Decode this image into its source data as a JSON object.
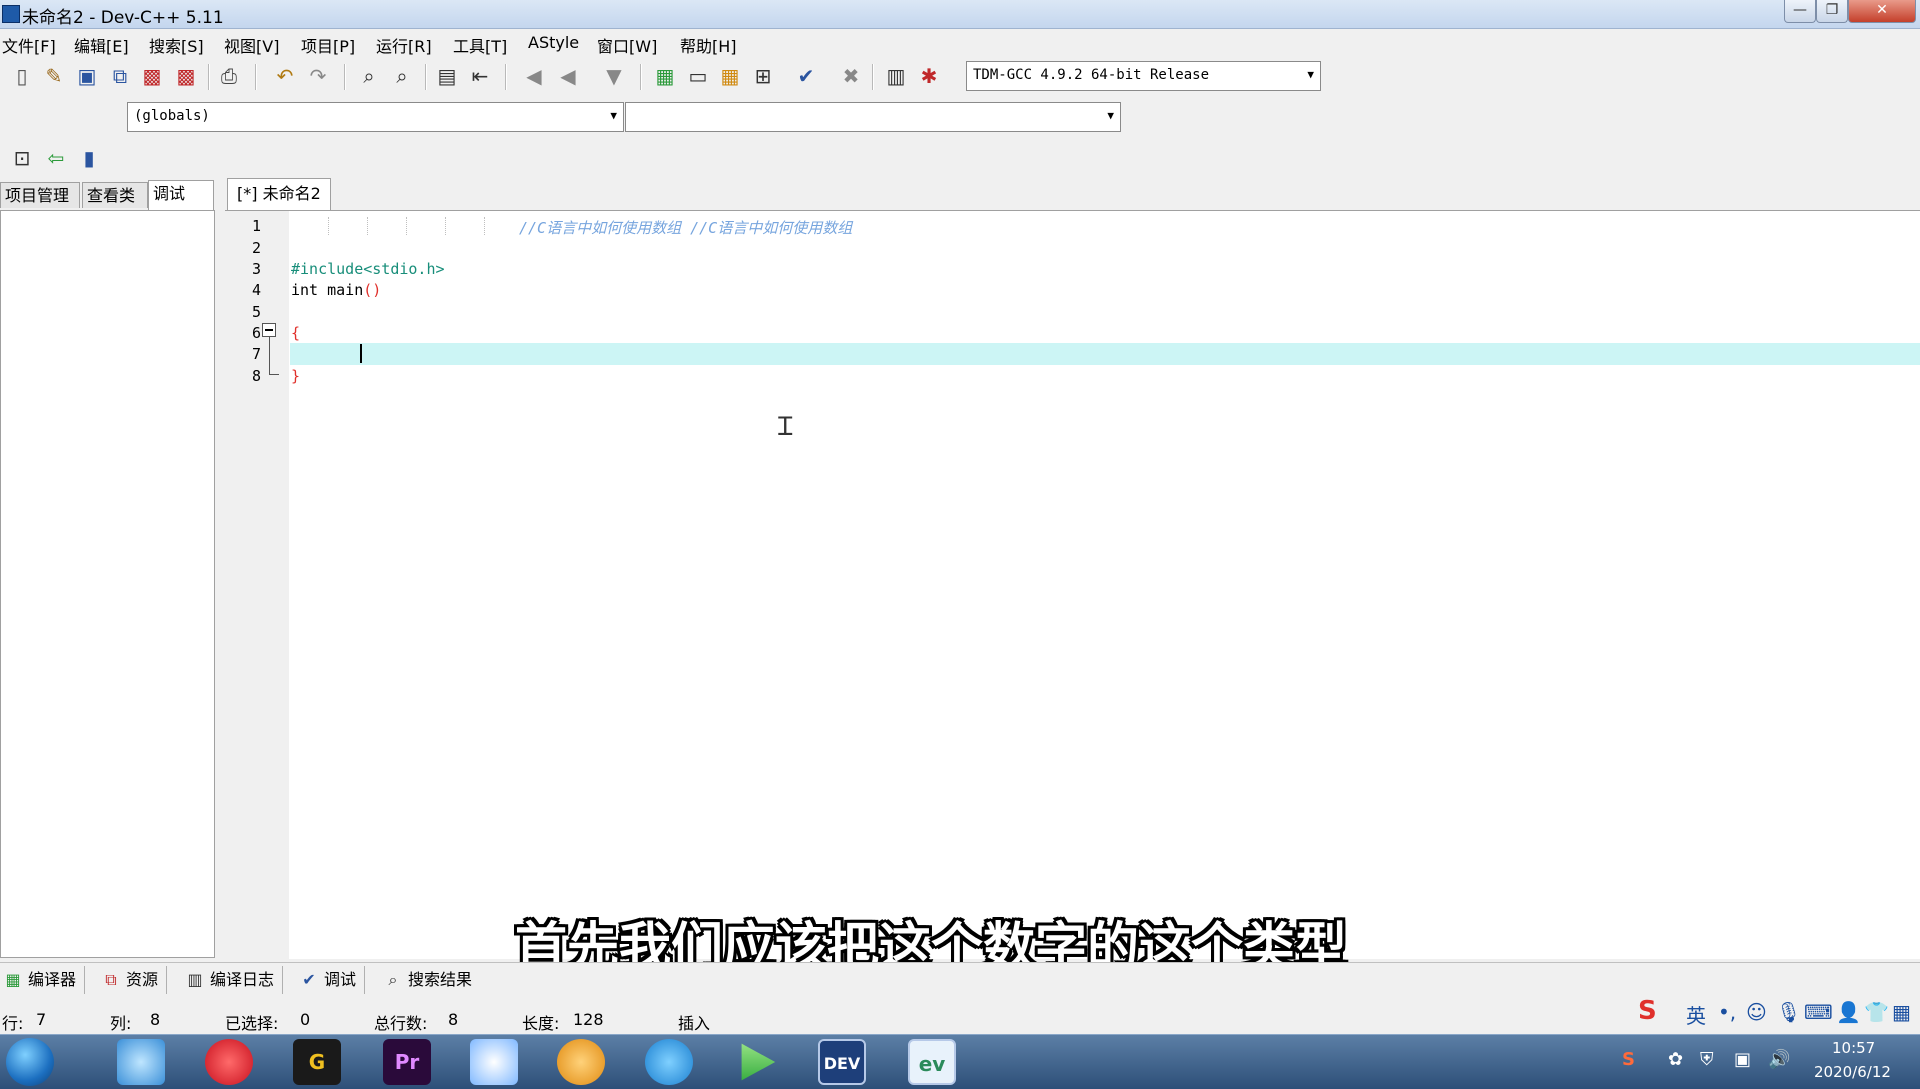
{
  "window": {
    "title": "未命名2 - Dev-C++ 5.11",
    "minimize": "—",
    "maximize": "❐",
    "close": "✕"
  },
  "menu": [
    "文件[F]",
    "编辑[E]",
    "搜索[S]",
    "视图[V]",
    "项目[P]",
    "运行[R]",
    "工具[T]",
    "AStyle",
    "窗口[W]",
    "帮助[H]"
  ],
  "toolbar": {
    "compiler_select": "TDM-GCC 4.9.2 64-bit Release",
    "scope_select": "(globals)",
    "symbol_select": ""
  },
  "left_tabs": [
    "项目管理",
    "查看类",
    "调试"
  ],
  "editor": {
    "tab_label": "[*] 未命名2",
    "line_numbers": [
      "1",
      "2",
      "3",
      "4",
      "5",
      "6",
      "7",
      "8"
    ],
    "lines": {
      "l1": "//C语言中如何使用数组 //C语言中如何使用数组",
      "l3": "#include<stdio.h>",
      "l4a": "int main",
      "l4b": "()",
      "l6": "{",
      "l8": "}"
    }
  },
  "bottom_tabs": [
    "编译器",
    "资源",
    "编译日志",
    "调试",
    "搜索结果"
  ],
  "status": {
    "row_label": "行:",
    "row": "7",
    "col_label": "列:",
    "col": "8",
    "sel_label": "已选择:",
    "sel": "0",
    "total_label": "总行数:",
    "total": "8",
    "len_label": "长度:",
    "len": "128",
    "mode": "插入"
  },
  "subtitle": "首先我们应该把这个数字的这个类型",
  "ime": {
    "lang": "英"
  },
  "taskbar": {
    "time": "10:57",
    "date": "2020/6/12",
    "apps": [
      "browser-icon",
      "netease-music-icon",
      "app-g-icon",
      "premiere-icon",
      "pinwheel-icon",
      "meow-icon",
      "edge-icon",
      "player-icon",
      "devcpp-icon",
      "ev-recorder-icon"
    ],
    "pr_label": "Pr",
    "dev_label": "DEV"
  }
}
